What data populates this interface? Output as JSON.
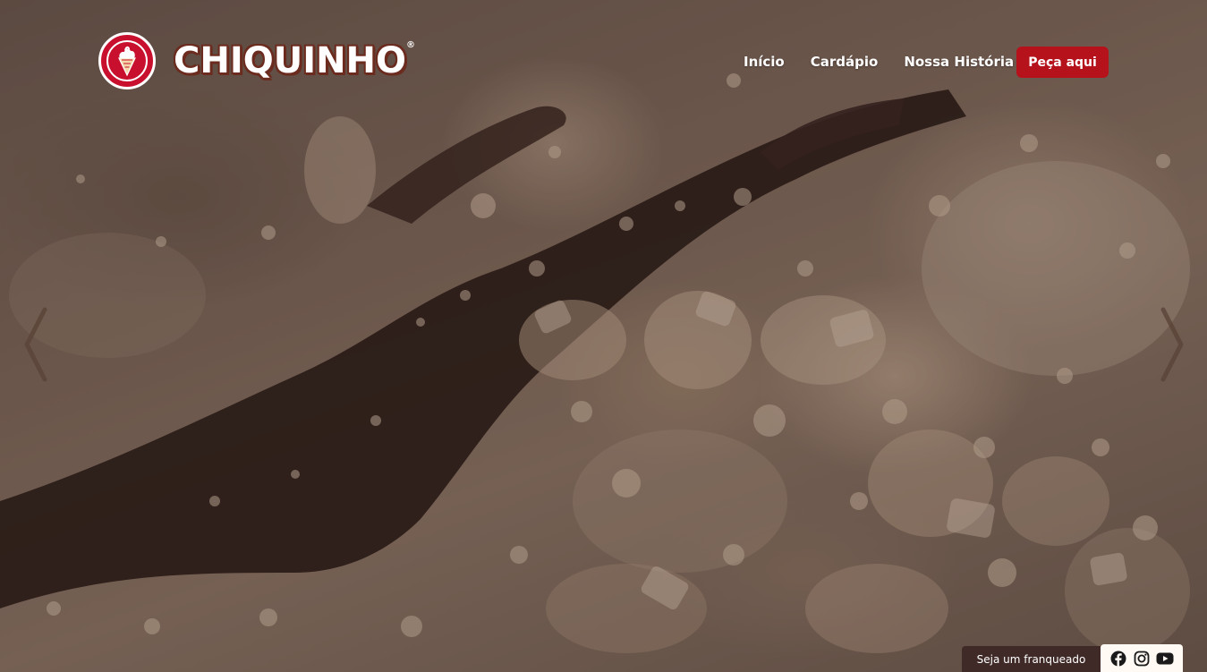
{
  "brand": {
    "name": "CHIQUINHO",
    "registered_mark": "®",
    "logo_icon": "ice-cream-cone-icon",
    "colors": {
      "brand_red": "#c8102e",
      "button_red": "#b5121b",
      "outline_brown": "#6b2b1e",
      "franchise_bg": "#3f2a27",
      "social_bg": "#fffaf3"
    }
  },
  "nav": {
    "items": [
      {
        "label": "Início"
      },
      {
        "label": "Cardápio"
      },
      {
        "label": "Nossa História"
      }
    ],
    "cta_label": "Peça aqui"
  },
  "slider": {
    "prev_icon": "chevron-left-icon",
    "next_icon": "chevron-right-icon"
  },
  "footer_bar": {
    "franchise_label": "Seja um franqueado",
    "social_icons": [
      "facebook-icon",
      "instagram-icon",
      "youtube-icon"
    ]
  }
}
